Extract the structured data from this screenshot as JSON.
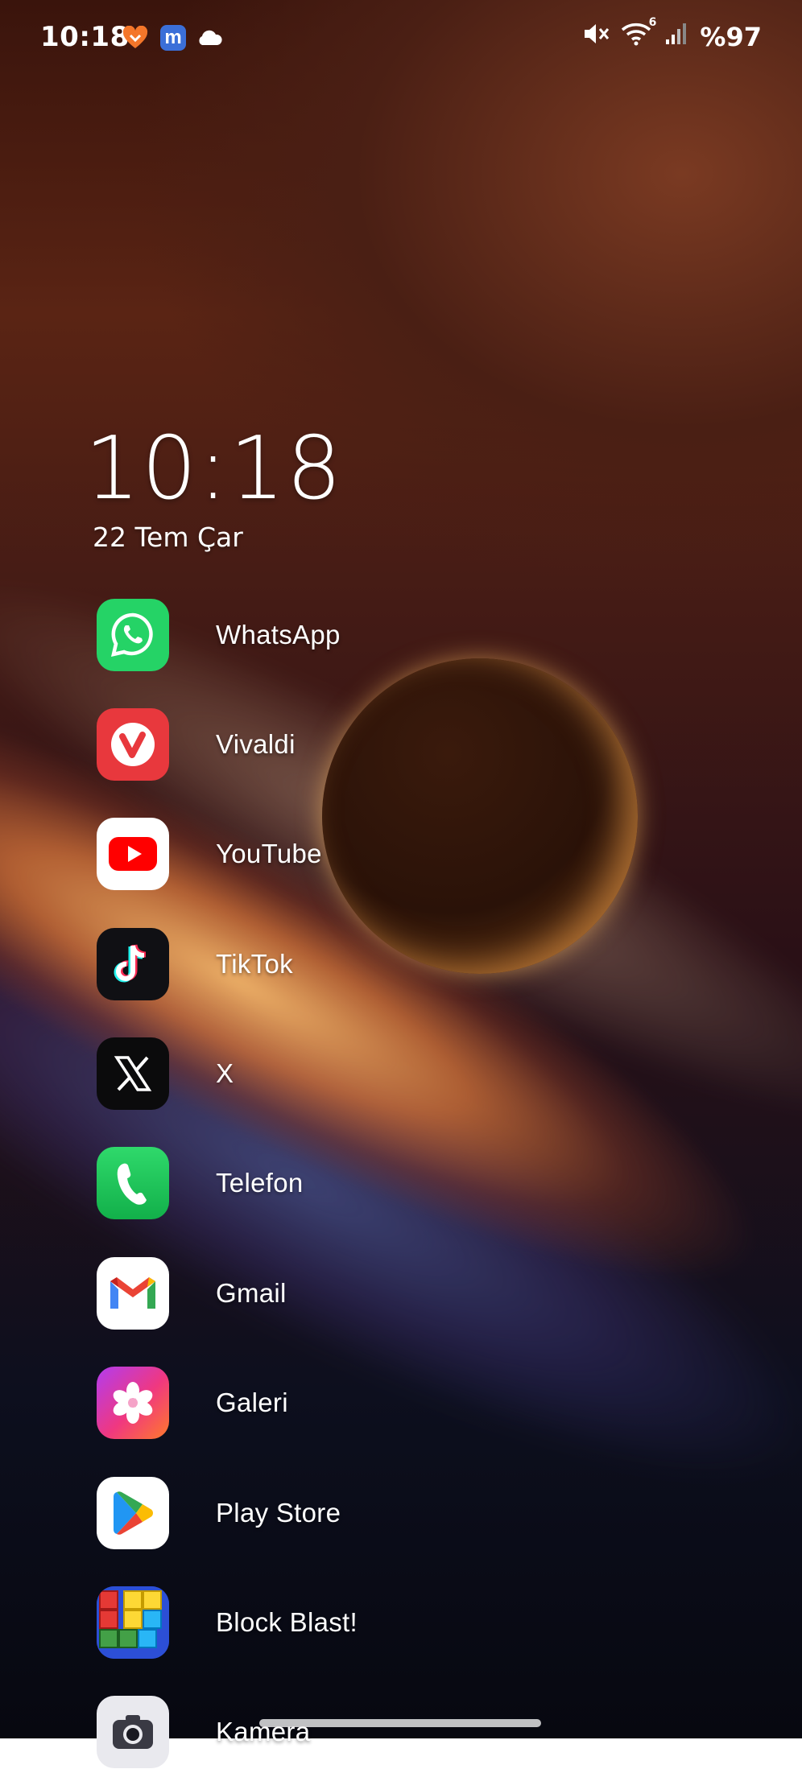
{
  "status_bar": {
    "time": "10:18",
    "battery": "%97",
    "wifi_badge": "6",
    "notification_icons": [
      "heart-app-icon",
      "m-app-icon",
      "cloud-icon"
    ],
    "system_icons": [
      "mute-icon",
      "wifi-icon",
      "signal-icon"
    ]
  },
  "clock_widget": {
    "time": "10:18",
    "date": "22 Tem Çar"
  },
  "apps": [
    {
      "label": "WhatsApp",
      "icon": "whatsapp-icon",
      "color": "#25D366"
    },
    {
      "label": "Vivaldi",
      "icon": "vivaldi-icon",
      "color": "#EF3939"
    },
    {
      "label": "YouTube",
      "icon": "youtube-icon",
      "color": "#FF0000"
    },
    {
      "label": "TikTok",
      "icon": "tiktok-icon",
      "color": "#010101"
    },
    {
      "label": "X",
      "icon": "x-icon",
      "color": "#000000"
    },
    {
      "label": "Telefon",
      "icon": "phone-icon",
      "color": "#1DBF5A"
    },
    {
      "label": "Gmail",
      "icon": "gmail-icon",
      "color": "#EA4335"
    },
    {
      "label": "Galeri",
      "icon": "gallery-icon",
      "color": "#E8398F"
    },
    {
      "label": "Play Store",
      "icon": "play-store-icon",
      "color": "#01875F"
    },
    {
      "label": "Block Blast!",
      "icon": "block-blast-icon",
      "color": "#2C4FD6"
    },
    {
      "label": "Kamera",
      "icon": "camera-icon",
      "color": "#E9E9EE"
    }
  ]
}
